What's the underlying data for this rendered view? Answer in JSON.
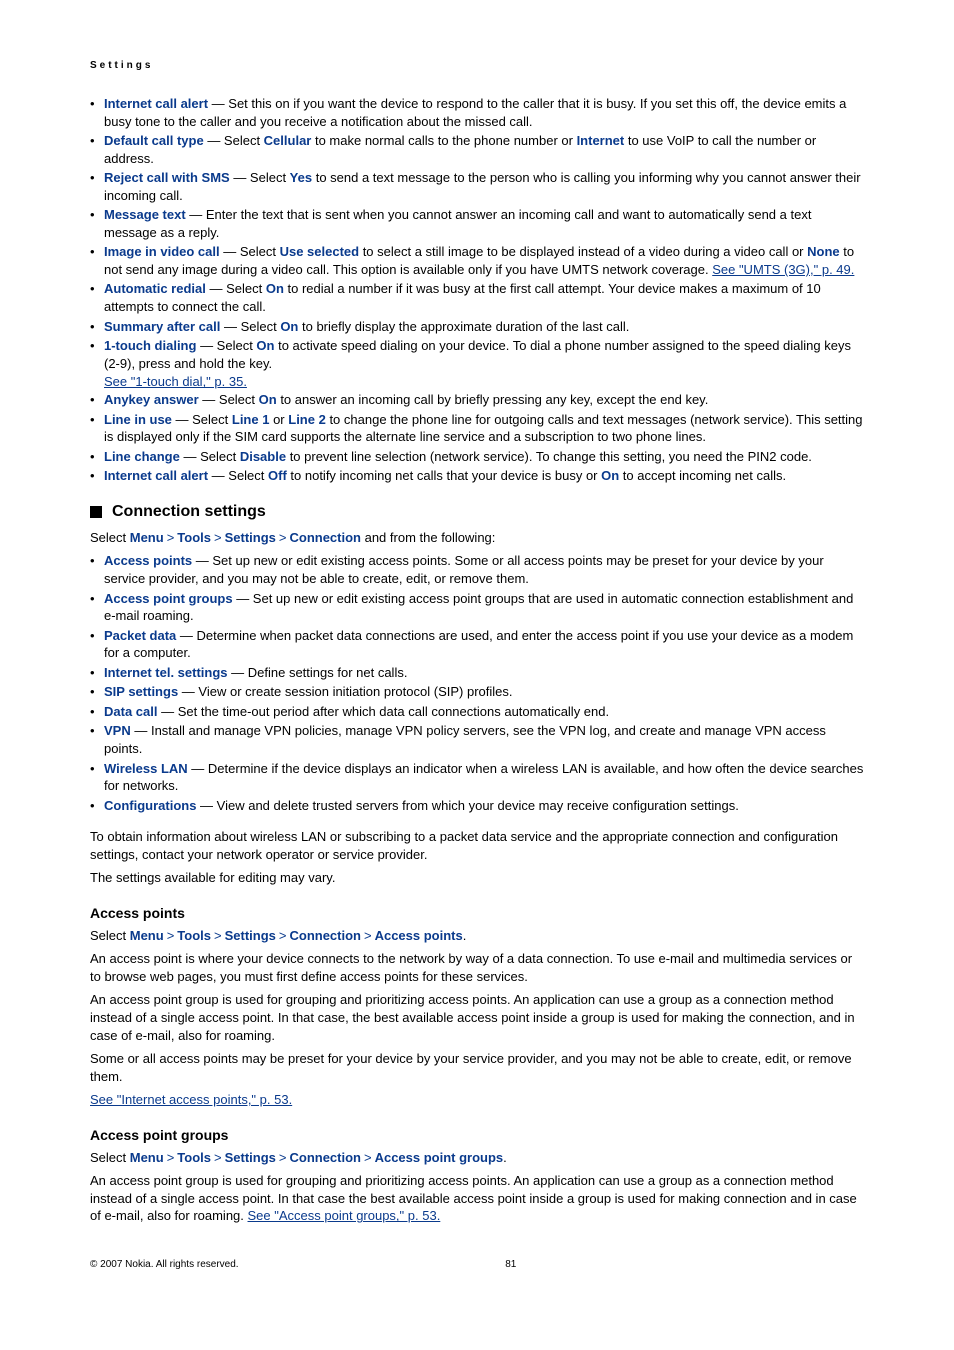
{
  "header": "Settings",
  "list1": [
    {
      "term": "Internet call alert",
      "body": " — Set this on if you want the device to respond to the caller that it is busy. If you set this off, the device emits a busy tone to the caller and you receive a notification about the missed call."
    },
    {
      "term": "Default call type",
      "body_pre": " — Select ",
      "v1": "Cellular",
      "mid": " to make normal calls to the phone number or ",
      "v2": "Internet",
      "body_post": " to use VoIP to call the number or address."
    },
    {
      "term": "Reject call with SMS",
      "body_pre": " — Select ",
      "v1": "Yes",
      "body_post": " to send a text message to the person who is calling you informing why you cannot answer their incoming call."
    },
    {
      "term": "Message text",
      "body": " — Enter the text that is sent when you cannot answer an incoming call and want to automatically send a text message as a reply."
    },
    {
      "term": "Image in video call",
      "body_pre": " — Select ",
      "v1": "Use selected",
      "mid": " to select a still image to be displayed instead of a video during a video call or ",
      "v2": "None",
      "body_post": " to not send any image during a video call. This option is available only if you have UMTS network coverage. ",
      "link": "See \"UMTS (3G),\" p. 49."
    },
    {
      "term": "Automatic redial",
      "body_pre": " — Select ",
      "v1": "On",
      "body_post": " to redial a number if it was busy at the first call attempt. Your device makes a maximum of 10 attempts to connect the call."
    },
    {
      "term": "Summary after call",
      "body_pre": " — Select ",
      "v1": "On",
      "body_post": " to briefly display the approximate duration of the last call."
    },
    {
      "term": "1-touch dialing",
      "body_pre": " — Select ",
      "v1": "On",
      "body_post": " to activate speed dialing on your device. To dial a phone number assigned to the speed dialing keys (2-9), press and hold the key.",
      "sublink": "See \"1-touch dial,\" p. 35."
    },
    {
      "term": "Anykey answer",
      "body_pre": " — Select ",
      "v1": "On",
      "body_post": " to answer an incoming call by briefly pressing any key, except the end key."
    },
    {
      "term": "Line in use",
      "body_pre": " — Select ",
      "v1": "Line 1",
      "mid": " or ",
      "v2": "Line 2",
      "body_post": " to change the phone line for outgoing calls and text messages (network service). This setting is displayed only if the SIM card supports the alternate line service and a subscription to two phone lines."
    },
    {
      "term": "Line change",
      "body_pre": " — Select ",
      "v1": "Disable",
      "body_post": " to prevent line selection (network service). To change this setting, you need the PIN2 code."
    },
    {
      "term": "Internet call alert",
      "body_pre": " — Select ",
      "v1": "Off",
      "mid": " to notify incoming net calls that your device is busy or ",
      "v2": "On",
      "body_post": " to accept incoming net calls."
    }
  ],
  "h2": "Connection settings",
  "crumb1": {
    "pre": "Select ",
    "parts": [
      "Menu",
      "Tools",
      "Settings",
      "Connection"
    ],
    "post": " and from the following:"
  },
  "list2": [
    {
      "term": "Access points",
      "body": " — Set up new or edit existing access points. Some or all access points may be preset for your device by your service provider, and you may not be able to create, edit, or remove them."
    },
    {
      "term": "Access point groups",
      "body": " — Set up new or edit existing access point groups that are used in automatic connection establishment and e-mail roaming."
    },
    {
      "term": "Packet data",
      "body": " — Determine when packet data connections are used, and enter the access point if you use your device as a modem for a computer."
    },
    {
      "term": "Internet tel. settings",
      "body": " — Define settings for net calls."
    },
    {
      "term": "SIP settings",
      "body": " — View or create session initiation protocol (SIP) profiles."
    },
    {
      "term": "Data call",
      "body": " — Set the time-out period after which data call connections automatically end."
    },
    {
      "term": "VPN",
      "body": " — Install and manage VPN policies, manage VPN policy servers, see the VPN log, and create and manage VPN access points."
    },
    {
      "term": "Wireless LAN",
      "body": " — Determine if the device displays an indicator when a wireless LAN is available, and how often the device searches for networks."
    },
    {
      "term": "Configurations",
      "body": " — View and delete trusted servers from which your device may receive configuration settings."
    }
  ],
  "para1": "To obtain information about wireless LAN or subscribing to a packet data service and the appropriate connection and configuration settings, contact your network operator or service provider.",
  "para2": "The settings available for editing may vary.",
  "h3a": "Access points",
  "crumb2": {
    "pre": "Select ",
    "parts": [
      "Menu",
      "Tools",
      "Settings",
      "Connection",
      "Access points"
    ],
    "post": "."
  },
  "ap_para1": "An access point is where your device connects to the network by way of a data connection. To use e-mail and multimedia services or to browse web pages, you must first define access points for these services.",
  "ap_para2": "An access point group is used for grouping and prioritizing access points. An application can use a group as a connection method instead of a single access point. In that case, the best available access point inside a group is used for making the connection, and in case of e-mail, also for roaming.",
  "ap_para3": "Some or all access points may be preset for your device by your service provider, and you may not be able to create, edit, or remove them.",
  "ap_link": "See \"Internet access points,\" p. 53.",
  "h3b": "Access point groups",
  "crumb3": {
    "pre": "Select ",
    "parts": [
      "Menu",
      "Tools",
      "Settings",
      "Connection",
      "Access point groups"
    ],
    "post": "."
  },
  "apg_para": "An access point group is used for grouping and prioritizing access points. An application can use a group as a connection method instead of a single access point. In that case the best available access point inside a group is used for making connection and in case of e-mail, also for roaming. ",
  "apg_link": "See \"Access point groups,\" p. 53.",
  "footer_left": "© 2007 Nokia. All rights reserved.",
  "footer_page": "81"
}
